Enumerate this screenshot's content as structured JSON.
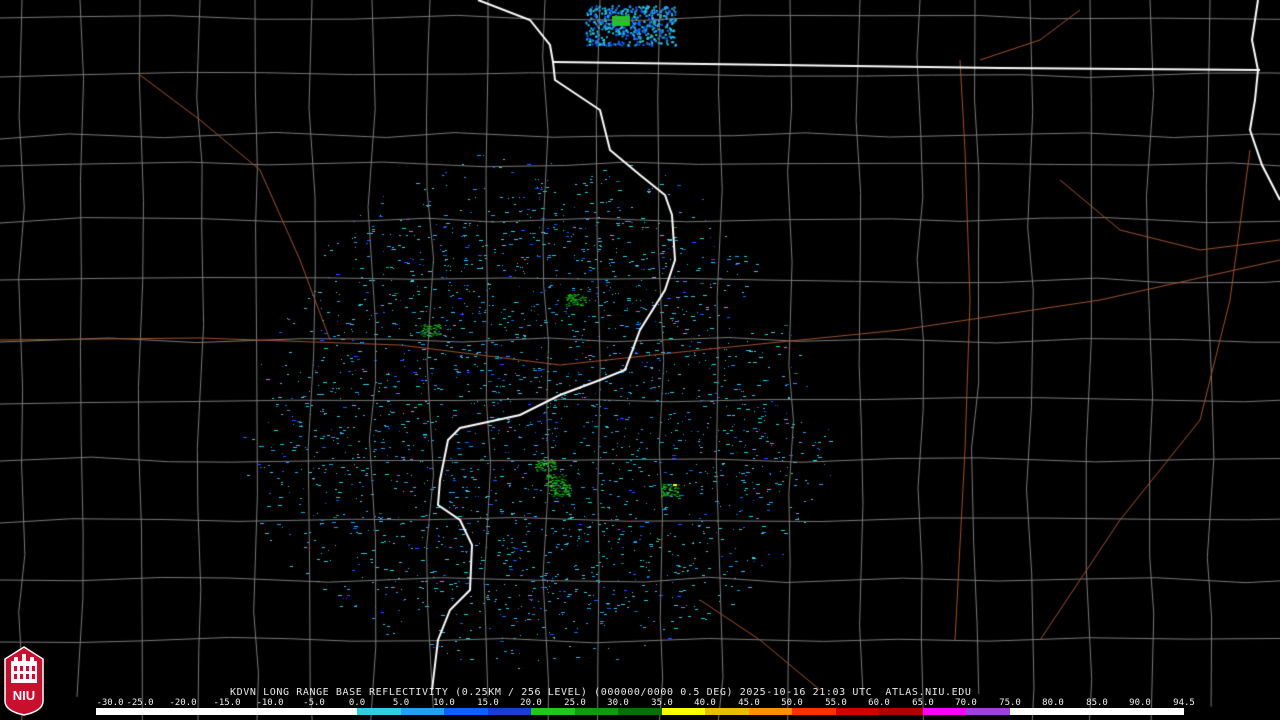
{
  "product": {
    "caption": "KDVN LONG RANGE BASE REFLECTIVITY (0.25KM / 256 LEVEL) (000000/0000 0.5 DEG) 2025-10-16 21:03 UTC  ATLAS.NIU.EDU"
  },
  "scale": {
    "labels": [
      "-30.0",
      "-25.0",
      "-20.0",
      "-15.0",
      "-10.0",
      "-5.0",
      "0.0",
      "5.0",
      "10.0",
      "15.0",
      "20.0",
      "25.0",
      "30.0",
      "35.0",
      "40.0",
      "45.0",
      "50.0",
      "55.0",
      "60.0",
      "65.0",
      "70.0",
      "75.0",
      "80.0",
      "85.0",
      "90.0",
      "94.5"
    ],
    "colors": [
      "#ffffff",
      "#ffffff",
      "#ffffff",
      "#ffffff",
      "#ffffff",
      "#ffffff",
      "#2cd0e0",
      "#1fa2ef",
      "#0f5fff",
      "#1a3dd6",
      "#1fc81f",
      "#129812",
      "#0a6f0a",
      "#ffff00",
      "#e6c000",
      "#ff9000",
      "#ff3000",
      "#d00000",
      "#b00000",
      "#ff00ff",
      "#a040e0",
      "#ffffff",
      "#ffffff",
      "#ffffff",
      "#ffffff"
    ]
  },
  "logo": {
    "text": "NIU",
    "color": "#c8102e"
  },
  "map_colors": {
    "state_border": "#ffffff",
    "county_line": "#8a8a8a",
    "highway": "#a0522d"
  }
}
